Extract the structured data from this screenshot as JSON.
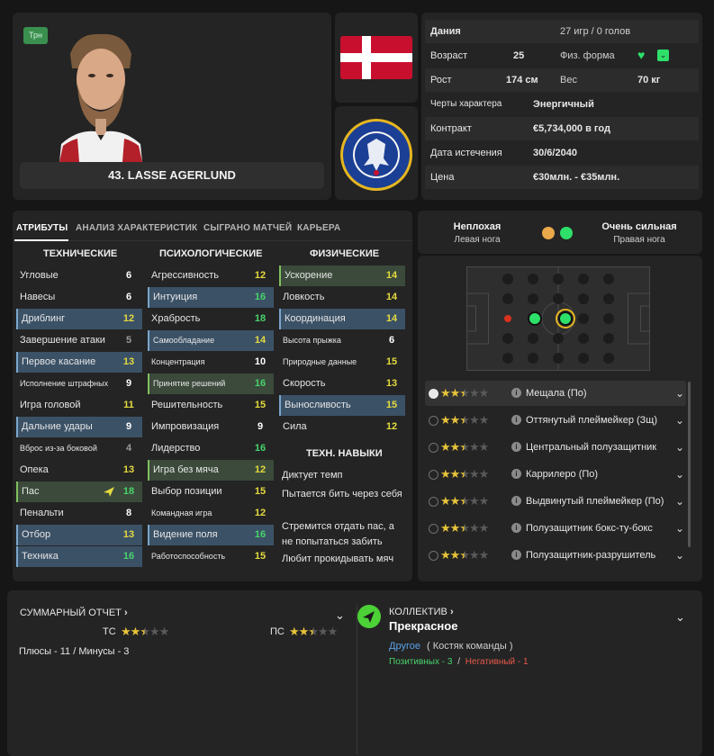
{
  "profile": {
    "badge": "Трн",
    "name": "43. LASSE AGERLUND"
  },
  "info": {
    "rows": [
      {
        "l1": "Дания",
        "v1": "",
        "l2": "27 игр / 0 голов",
        "v2": ""
      },
      {
        "l1": "Возраст",
        "v1": "25",
        "l2": "Физ. форма",
        "v2": ""
      },
      {
        "l1": "Рост",
        "v1": "174 см",
        "l2": "Вес",
        "v2": "70 кг"
      },
      {
        "l1": "Черты характера",
        "v1": "Энергичный",
        "l2": "",
        "v2": ""
      },
      {
        "l1": "Контракт",
        "v1": "€5,734,000 в год",
        "l2": "",
        "v2": ""
      },
      {
        "l1": "Дата истечения",
        "v1": "30/6/2040",
        "l2": "",
        "v2": ""
      },
      {
        "l1": "Цена",
        "v1": "€30млн. - €35млн.",
        "l2": "",
        "v2": ""
      }
    ]
  },
  "tabs": [
    "АТРИБУТЫ",
    "АНАЛИЗ ХАРАКТЕРИСТИК",
    "СЫГРАНО МАТЧЕЙ",
    "КАРЬЕРА"
  ],
  "columns": {
    "technical": {
      "title": "ТЕХНИЧЕСКИЕ",
      "items": [
        {
          "name": "Угловые",
          "value": "6"
        },
        {
          "name": "Навесы",
          "value": "6"
        },
        {
          "name": "Дриблинг",
          "value": "12"
        },
        {
          "name": "Завершение атаки",
          "value": "5"
        },
        {
          "name": "Первое касание",
          "value": "13"
        },
        {
          "name": "Исполнение штрафных",
          "value": "9"
        },
        {
          "name": "Игра головой",
          "value": "11"
        },
        {
          "name": "Дальние удары",
          "value": "9"
        },
        {
          "name": "Вброс из-за боковой",
          "value": "4"
        },
        {
          "name": "Опека",
          "value": "13"
        },
        {
          "name": "Пас",
          "value": "18"
        },
        {
          "name": "Пенальти",
          "value": "8"
        },
        {
          "name": "Отбор",
          "value": "13"
        },
        {
          "name": "Техника",
          "value": "16"
        }
      ]
    },
    "mental": {
      "title": "ПСИХОЛОГИЧЕСКИЕ",
      "items": [
        {
          "name": "Агрессивность",
          "value": "12"
        },
        {
          "name": "Интуиция",
          "value": "16"
        },
        {
          "name": "Храбрость",
          "value": "18"
        },
        {
          "name": "Самообладание",
          "value": "14"
        },
        {
          "name": "Концентрация",
          "value": "10"
        },
        {
          "name": "Принятие решений",
          "value": "16"
        },
        {
          "name": "Решительность",
          "value": "15"
        },
        {
          "name": "Импровизация",
          "value": "9"
        },
        {
          "name": "Лидерство",
          "value": "16"
        },
        {
          "name": "Игра без мяча",
          "value": "12"
        },
        {
          "name": "Выбор позиции",
          "value": "15"
        },
        {
          "name": "Командная игра",
          "value": "12"
        },
        {
          "name": "Видение поля",
          "value": "16"
        },
        {
          "name": "Работоспособность",
          "value": "15"
        }
      ]
    },
    "physical": {
      "title": "ФИЗИЧЕСКИЕ",
      "items": [
        {
          "name": "Ускорение",
          "value": "14"
        },
        {
          "name": "Ловкость",
          "value": "14"
        },
        {
          "name": "Координация",
          "value": "14"
        },
        {
          "name": "Высота прыжка",
          "value": "6"
        },
        {
          "name": "Природные данные",
          "value": "15"
        },
        {
          "name": "Скорость",
          "value": "13"
        },
        {
          "name": "Выносливость",
          "value": "15"
        },
        {
          "name": "Сила",
          "value": "12"
        }
      ]
    }
  },
  "traits": {
    "title": "ТЕХН. НАВЫКИ",
    "items": [
      "Диктует темп",
      "Пытается бить через себя",
      "Стремится отдать пас, а не попытаться забить",
      "Любит прокидывать мяч"
    ]
  },
  "feet": {
    "left": {
      "label": "Неплохая",
      "sub": "Левая нога",
      "color": "#e9a94a"
    },
    "right": {
      "label": "Очень сильная",
      "sub": "Правая нога",
      "color": "#2ee06a"
    }
  },
  "roles": [
    {
      "name": "Мещала (По)",
      "stars": 2.5
    },
    {
      "name": "Оттянутый плеймейкер (Зщ)",
      "stars": 2.5
    },
    {
      "name": "Центральный полузащитник",
      "stars": 2.5
    },
    {
      "name": "Каррилеро (По)",
      "stars": 2.5
    },
    {
      "name": "Выдвинутый плеймейкер (По)",
      "stars": 2.5
    },
    {
      "name": "Полузащитник бокс-ту-бокс",
      "stars": 2.5
    },
    {
      "name": "Полузащитник-разрушитель",
      "stars": 2.5
    }
  ],
  "summary": {
    "title": "СУММАРНЫЙ ОТЧЕТ",
    "tc_label": "ТС",
    "pc_label": "ПС",
    "tc_stars": 2.5,
    "pc_stars": 2.5,
    "plus_minus": "Плюсы - 11 / Минусы - 3"
  },
  "collective": {
    "title": "КОЛЛЕКТИВ",
    "value": "Прекрасное",
    "group_link": "Другое",
    "group_note": "( Костяк команды )",
    "positive": "Позитивных - 3",
    "sep": "/",
    "negative": "Негативный - 1"
  },
  "colors": {
    "accent_green": "#49d36b",
    "accent_yellow": "#e4da3f",
    "highlight_blue": "#3b5166",
    "highlight_green": "#3b4a3b",
    "star": "#e6c33a"
  }
}
